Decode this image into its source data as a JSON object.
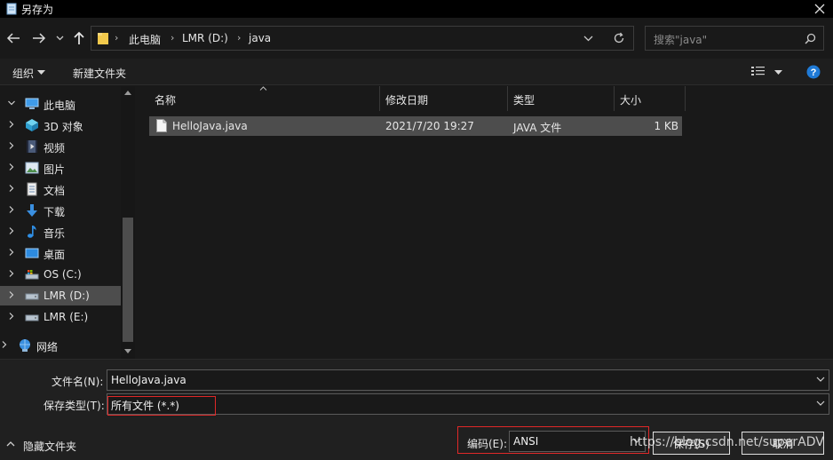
{
  "window": {
    "title": "另存为"
  },
  "address": {
    "crumbs": [
      "此电脑",
      "LMR (D:)",
      "java"
    ],
    "search_placeholder": "搜索\"java\""
  },
  "toolbar": {
    "organize": "组织",
    "new_folder": "新建文件夹"
  },
  "nav": {
    "items": [
      {
        "label": "此电脑",
        "icon": "computer-icon"
      },
      {
        "label": "3D 对象",
        "icon": "cube-3d-icon"
      },
      {
        "label": "视频",
        "icon": "video-icon"
      },
      {
        "label": "图片",
        "icon": "pictures-icon"
      },
      {
        "label": "文档",
        "icon": "documents-icon"
      },
      {
        "label": "下载",
        "icon": "download-icon"
      },
      {
        "label": "音乐",
        "icon": "music-icon"
      },
      {
        "label": "桌面",
        "icon": "desktop-icon"
      },
      {
        "label": "OS (C:)",
        "icon": "drive-c-icon"
      },
      {
        "label": "LMR (D:)",
        "icon": "drive-icon",
        "selected": true
      },
      {
        "label": "LMR (E:)",
        "icon": "drive-icon"
      },
      {
        "label": "网络",
        "icon": "network-icon"
      }
    ]
  },
  "columns": {
    "name": "名称",
    "modified": "修改日期",
    "type": "类型",
    "size": "大小"
  },
  "files": [
    {
      "name": "HelloJava.java",
      "modified": "2021/7/20 19:27",
      "type": "JAVA 文件",
      "size": "1 KB"
    }
  ],
  "form": {
    "filename_label": "文件名(N):",
    "filename_value": "HelloJava.java",
    "filetype_label": "保存类型(T):",
    "filetype_value": "所有文件  (*.*)",
    "encoding_label": "编码(E):",
    "encoding_value": "ANSI",
    "hide_folders": "隐藏文件夹",
    "save": "保存(S)",
    "cancel": "取消"
  },
  "watermark": "https://blog.csdn.net/superADV",
  "colors": {
    "selected": "#4d4d4d",
    "highlight_box": "#e02828",
    "background": "#191919"
  }
}
